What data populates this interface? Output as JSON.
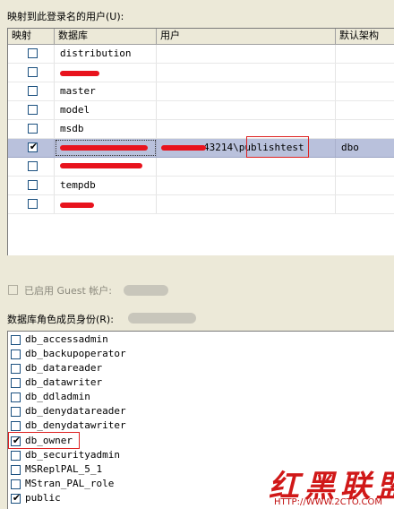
{
  "users_section": {
    "label": "映射到此登录名的用户(U):"
  },
  "users_table": {
    "columns": [
      "映射",
      "数据库",
      "用户",
      "默认架构"
    ],
    "rows": [
      {
        "mapped": false,
        "database": "distribution",
        "user": "",
        "schema": ""
      },
      {
        "mapped": false,
        "database": "",
        "user": "",
        "schema": ""
      },
      {
        "mapped": false,
        "database": "master",
        "user": "",
        "schema": ""
      },
      {
        "mapped": false,
        "database": "model",
        "user": "",
        "schema": ""
      },
      {
        "mapped": false,
        "database": "msdb",
        "user": "",
        "schema": ""
      },
      {
        "mapped": true,
        "database": "",
        "user": "43214\\publishtest",
        "schema": "dbo"
      },
      {
        "mapped": false,
        "database": "",
        "user": "",
        "schema": ""
      },
      {
        "mapped": false,
        "database": "tempdb",
        "user": "",
        "schema": ""
      },
      {
        "mapped": false,
        "database": "",
        "user": "",
        "schema": ""
      }
    ],
    "check_mark": "✔"
  },
  "guest": {
    "label": "已启用 Guest 帐户:"
  },
  "roles_section": {
    "label": "数据库角色成员身份(R):"
  },
  "roles": [
    {
      "name": "db_accessadmin",
      "checked": false
    },
    {
      "name": "db_backupoperator",
      "checked": false
    },
    {
      "name": "db_datareader",
      "checked": false
    },
    {
      "name": "db_datawriter",
      "checked": false
    },
    {
      "name": "db_ddladmin",
      "checked": false
    },
    {
      "name": "db_denydatareader",
      "checked": false
    },
    {
      "name": "db_denydatawriter",
      "checked": false
    },
    {
      "name": "db_owner",
      "checked": true
    },
    {
      "name": "db_securityadmin",
      "checked": false
    },
    {
      "name": "MSReplPAL_5_1",
      "checked": false
    },
    {
      "name": "MStran_PAL_role",
      "checked": false
    },
    {
      "name": "public",
      "checked": true
    }
  ],
  "watermark": {
    "logo": "红黑联盟",
    "url": "HTTP://WWW.2CTO.COM"
  },
  "colors": {
    "selected_row": "#b9c1dc",
    "highlight_red": "#e8131d",
    "window_bg": "#ece9d8"
  }
}
